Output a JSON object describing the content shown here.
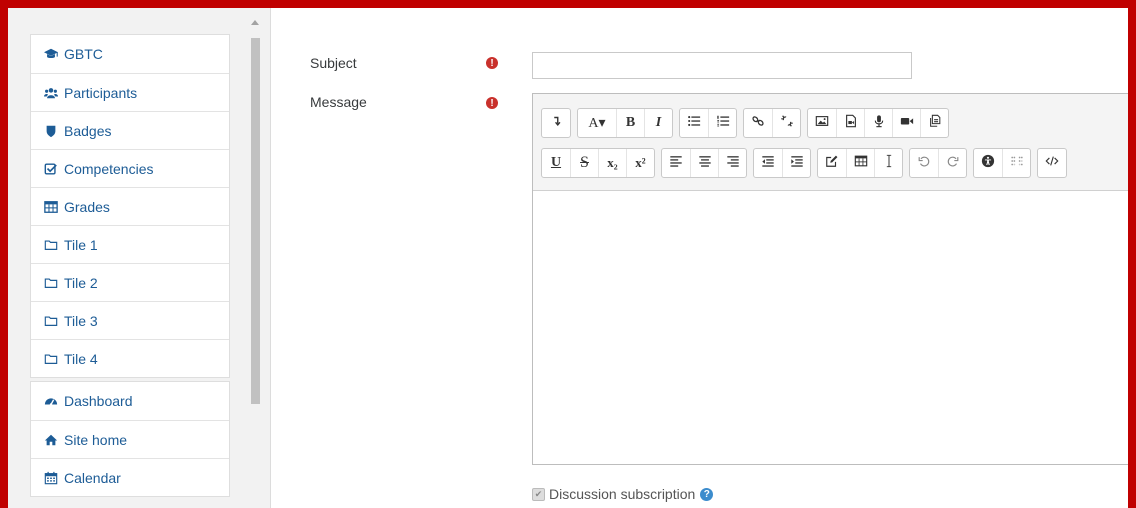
{
  "nav": {
    "group1": [
      {
        "label": "GBTC",
        "icon": "graduation-cap-icon"
      },
      {
        "label": "Participants",
        "icon": "users-icon"
      },
      {
        "label": "Badges",
        "icon": "shield-icon"
      },
      {
        "label": "Competencies",
        "icon": "check-square-icon"
      },
      {
        "label": "Grades",
        "icon": "table-icon"
      },
      {
        "label": "Tile 1",
        "icon": "folder-icon"
      },
      {
        "label": "Tile 2",
        "icon": "folder-icon"
      },
      {
        "label": "Tile 3",
        "icon": "folder-icon"
      },
      {
        "label": "Tile 4",
        "icon": "folder-icon"
      }
    ],
    "group2": [
      {
        "label": "Dashboard",
        "icon": "tachometer-icon"
      },
      {
        "label": "Site home",
        "icon": "home-icon"
      },
      {
        "label": "Calendar",
        "icon": "calendar-icon"
      }
    ]
  },
  "form": {
    "subject_label": "Subject",
    "message_label": "Message",
    "required_glyph": "!",
    "subject_value": "",
    "subscription_label": "Discussion subscription",
    "help_glyph": "?"
  },
  "toolbar": {
    "font_glyph": "A▾",
    "bold_glyph": "B",
    "italic_glyph": "I",
    "underline_glyph": "U",
    "strike_glyph": "S",
    "subscript_glyph": "x₂",
    "superscript_glyph": "x²"
  },
  "colors": {
    "frame": "#c00000",
    "link": "#1d5c96",
    "required": "#c9312c",
    "help": "#3c8ccd"
  }
}
